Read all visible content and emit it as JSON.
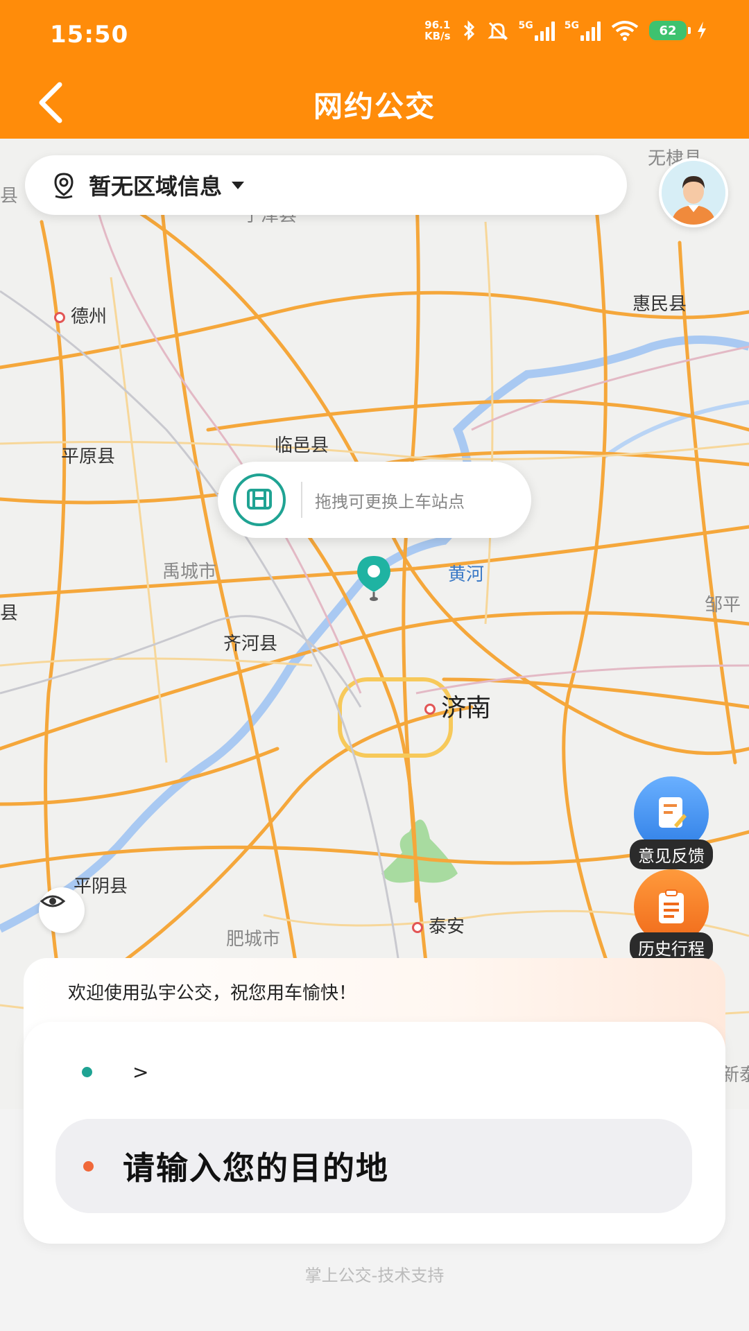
{
  "status_bar": {
    "time": "15:50",
    "net_speed_value": "96.1",
    "net_speed_unit": "KB/s",
    "sim1_label": "5G",
    "sim2_label": "5G",
    "battery": "62",
    "icons": [
      "bluetooth-icon",
      "mute-icon",
      "wifi-icon",
      "charging-icon"
    ]
  },
  "header": {
    "title": "网约公交",
    "back_icon": "chevron-left-icon"
  },
  "region": {
    "label": "暂无区域信息"
  },
  "map": {
    "labels": {
      "dezhou": "德州",
      "huiminxian": "惠民县",
      "pingyuanxian": "平原县",
      "linyixian": "临邑县",
      "yuchengshi": "禹城市",
      "qihexian": "齐河县",
      "jinan": "济南",
      "huanghe": "黄河",
      "pingyinxian": "平阴县",
      "feichengshi": "肥城市",
      "taian": "泰安",
      "ningjinxian": "宁津县",
      "wudixian": "无棣县",
      "zoupingshi": "邹平",
      "jingxian": "景县",
      "gaotangxian": "唐县",
      "xintai": "新泰"
    },
    "tooltip": "拖拽可更换上车站点"
  },
  "floating_buttons": {
    "feedback": "意见反馈",
    "history": "历史行程"
  },
  "welcome_text": "欢迎使用弘宇公交，祝您用车愉快！",
  "trip": {
    "origin_value": "",
    "origin_chevron": ">",
    "destination_placeholder": "请输入您的目的地"
  },
  "footer": "掌上公交-技术支持",
  "colors": {
    "brand_orange": "#ff8c0a",
    "accent_teal": "#1fa393",
    "dest_dot": "#f0683a",
    "road": "#f5a73b",
    "river": "#a9c9f2"
  }
}
